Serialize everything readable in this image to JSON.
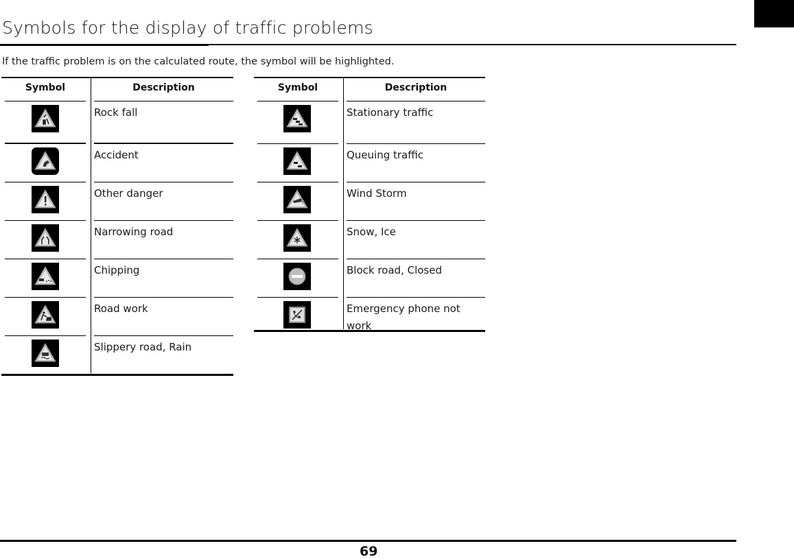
{
  "page": {
    "title": "Symbols for the display of traffic problems",
    "intro": "If the traffic problem is on the calculated route, the symbol will be highlighted.",
    "page_number": "69"
  },
  "tables": [
    {
      "headers": {
        "symbol": "Symbol",
        "description": "Description"
      },
      "rows": [
        {
          "icon": "rock-fall-icon",
          "description": "Rock fall"
        },
        {
          "icon": "accident-icon",
          "description": "Accident"
        },
        {
          "icon": "other-danger-icon",
          "description": "Other danger"
        },
        {
          "icon": "narrowing-road-icon",
          "description": "Narrowing road"
        },
        {
          "icon": "chipping-icon",
          "description": "Chipping"
        },
        {
          "icon": "road-work-icon",
          "description": "Road work"
        },
        {
          "icon": "slippery-road-icon",
          "description": "Slippery road, Rain"
        }
      ]
    },
    {
      "headers": {
        "symbol": "Symbol",
        "description": "Description"
      },
      "rows": [
        {
          "icon": "stationary-traffic-icon",
          "description": "Stationary traffic"
        },
        {
          "icon": "queuing-traffic-icon",
          "description": "Queuing traffic"
        },
        {
          "icon": "wind-storm-icon",
          "description": "Wind Storm"
        },
        {
          "icon": "snow-ice-icon",
          "description": "Snow, Ice"
        },
        {
          "icon": "road-closed-icon",
          "description": "Block road, Closed"
        },
        {
          "icon": "emergency-phone-icon",
          "description": "Emergency phone not work"
        }
      ]
    }
  ]
}
